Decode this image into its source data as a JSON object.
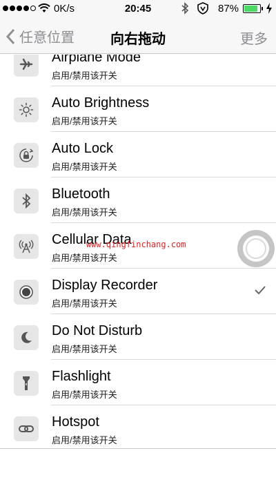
{
  "status_bar": {
    "carrier_speed": "0K/s",
    "time": "20:45",
    "battery_percent": "87%",
    "battery_level": 0.87
  },
  "nav": {
    "back_label": "任意位置",
    "title": "向右拖动",
    "more_label": "更多"
  },
  "rows": [
    {
      "name": "Airplane Mode",
      "sub": "启用/禁用该开关",
      "icon": "airplane-icon"
    },
    {
      "name": "Auto Brightness",
      "sub": "启用/禁用该开关",
      "icon": "brightness-icon"
    },
    {
      "name": "Auto Lock",
      "sub": "启用/禁用该开关",
      "icon": "lock-icon"
    },
    {
      "name": "Bluetooth",
      "sub": "启用/禁用该开关",
      "icon": "bluetooth-icon"
    },
    {
      "name": "Cellular Data",
      "sub": "启用/禁用该开关",
      "icon": "cellular-icon"
    },
    {
      "name": "Display Recorder",
      "sub": "启用/禁用该开关",
      "icon": "record-icon",
      "checked": true
    },
    {
      "name": "Do Not Disturb",
      "sub": "启用/禁用该开关",
      "icon": "moon-icon"
    },
    {
      "name": "Flashlight",
      "sub": "启用/禁用该开关",
      "icon": "flashlight-icon"
    },
    {
      "name": "Hotspot",
      "sub": "启用/禁用该开关",
      "icon": "hotspot-icon"
    }
  ],
  "watermark": "www.qingfinchang.com",
  "colors": {
    "accent_gray": "#8e8e93",
    "battery_green": "#4cd964",
    "watermark_red": "#e02020"
  }
}
